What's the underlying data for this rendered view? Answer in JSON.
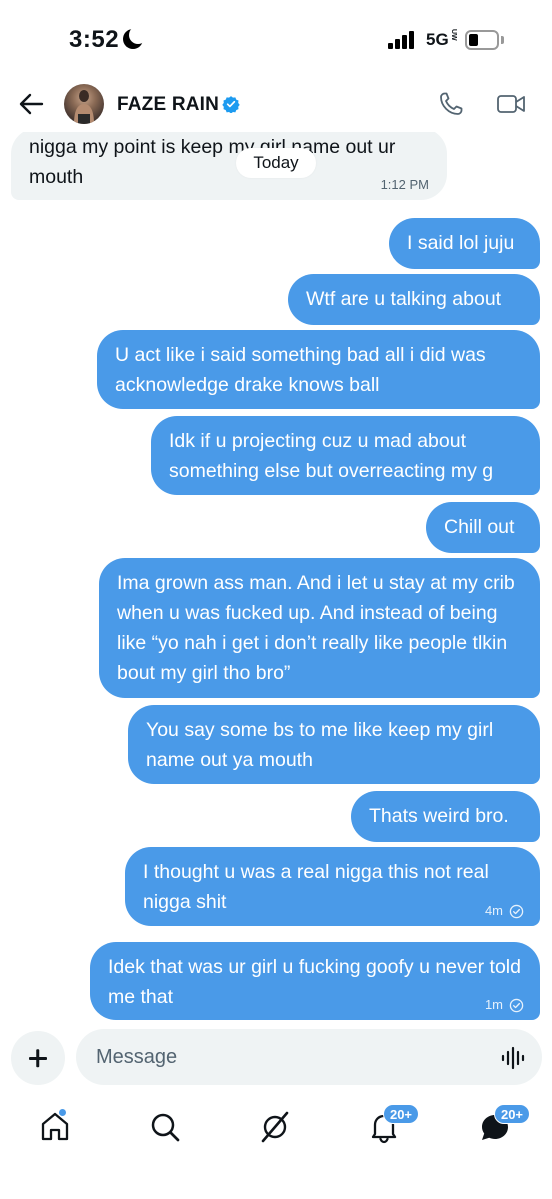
{
  "status_bar": {
    "time": "3:52",
    "network": "5G",
    "network_sub": "UW"
  },
  "header": {
    "contact_name": "FAZE RAIN",
    "verified": true
  },
  "date_separator": "Today",
  "messages": [
    {
      "direction": "incoming",
      "text": "nigga my point is keep my girl name out ur mouth",
      "time": "1:12 PM"
    },
    {
      "direction": "outgoing",
      "text": "I said lol juju"
    },
    {
      "direction": "outgoing",
      "text": "Wtf are u talking about"
    },
    {
      "direction": "outgoing",
      "text": "U act like i said something bad all i did was acknowledge drake knows ball"
    },
    {
      "direction": "outgoing",
      "text": "Idk if u projecting cuz u mad about something else but overreacting my g"
    },
    {
      "direction": "outgoing",
      "text": "Chill out"
    },
    {
      "direction": "outgoing",
      "text": "Ima grown ass man. And i let u stay at my crib when u was fucked up. And instead of being like “yo nah i get i don’t really like people tlkin bout my girl tho bro”"
    },
    {
      "direction": "outgoing",
      "text": "You say some bs to me like keep my girl name out ya mouth"
    },
    {
      "direction": "outgoing",
      "text": "Thats weird bro."
    },
    {
      "direction": "outgoing",
      "text": "I thought u was a real nigga this not real nigga shit",
      "time": "4m",
      "status": "sent"
    },
    {
      "direction": "outgoing",
      "text": "Idek that was ur girl u fucking goofy u never told me that",
      "time": "1m",
      "status": "sent"
    }
  ],
  "composer": {
    "placeholder": "Message"
  },
  "tabbar": {
    "notifications_badge": "20+",
    "messages_badge": "20+"
  },
  "colors": {
    "accent": "#4a9ae8",
    "incoming_bubble": "#eff3f4",
    "text": "#0f1419"
  }
}
